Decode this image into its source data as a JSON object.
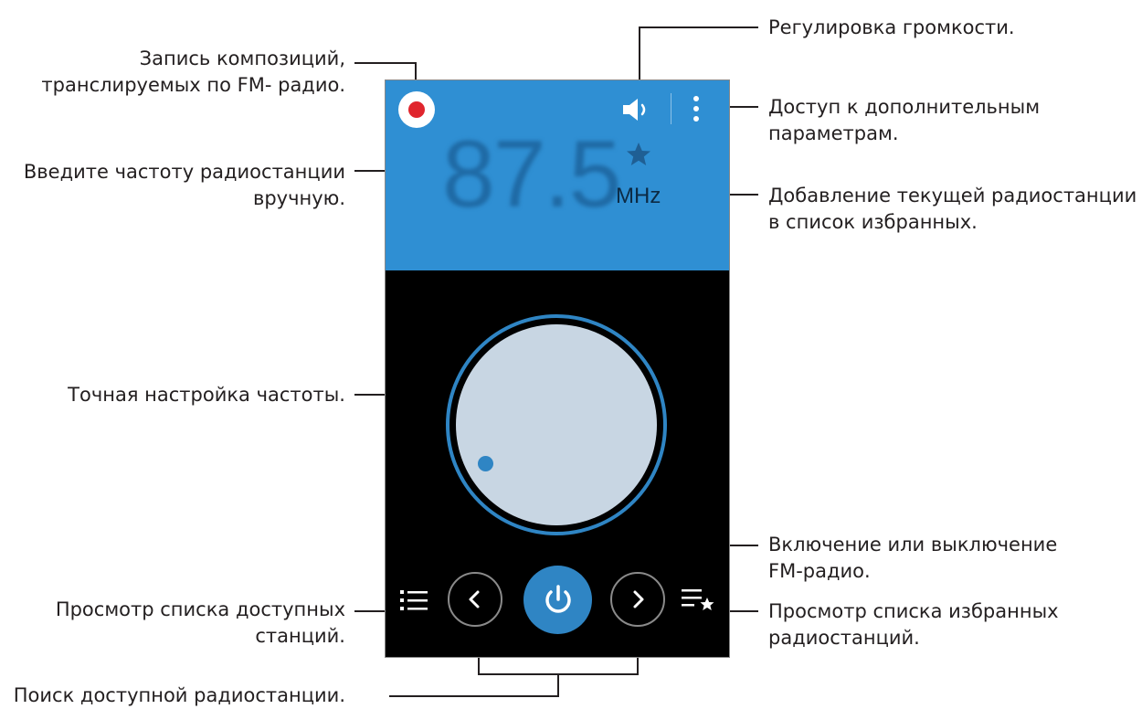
{
  "screen": {
    "frequency": "87.5",
    "unit": "MHz"
  },
  "callouts": {
    "record": "Запись композиций,\nтранслируемых по FM- радио.",
    "frequency_input": "Введите частоту радиостанции\nвручную.",
    "fine_tune": "Точная настройка частоты.",
    "station_list": "Просмотр списка доступных\nстанций.",
    "search": "Поиск доступной радиостанции.",
    "volume": "Регулировка громкости.",
    "more_options": "Доступ к дополнительным\nпараметрам.",
    "add_favorite": "Добавление текущей радиостанции\nв список избранных.",
    "power": "Включение или выключение\nFM-радио.",
    "favorites_list": "Просмотр списка избранных\nрадиостанций."
  },
  "icons": {
    "record": "record-icon",
    "volume": "volume-icon",
    "more": "more-options-icon",
    "favorite": "star-icon",
    "list": "list-icon",
    "prev": "chevron-left-icon",
    "power": "power-icon",
    "next": "chevron-right-icon",
    "favorites_list": "favorites-list-icon"
  },
  "colors": {
    "header_bg": "#2f8fd3",
    "accent": "#2f85c4",
    "record": "#e0252d",
    "dial": "#c8d6e3",
    "screen_bg": "#000000"
  }
}
